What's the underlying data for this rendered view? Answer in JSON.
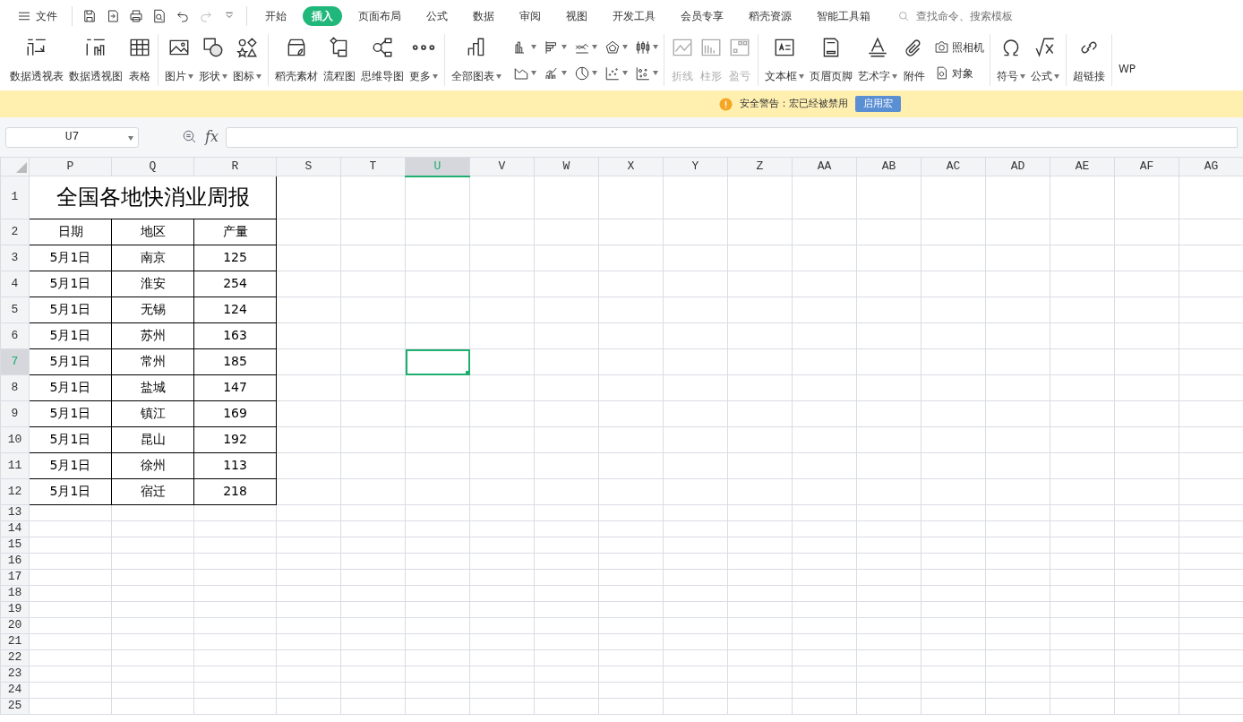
{
  "menu": {
    "file_label": "文件",
    "tabs": [
      {
        "label": "开始",
        "selected": false
      },
      {
        "label": "插入",
        "selected": true
      },
      {
        "label": "页面布局",
        "selected": false
      },
      {
        "label": "公式",
        "selected": false
      },
      {
        "label": "数据",
        "selected": false
      },
      {
        "label": "审阅",
        "selected": false
      },
      {
        "label": "视图",
        "selected": false
      },
      {
        "label": "开发工具",
        "selected": false
      },
      {
        "label": "会员专享",
        "selected": false
      },
      {
        "label": "稻壳资源",
        "selected": false
      },
      {
        "label": "智能工具箱",
        "selected": false
      }
    ],
    "search": {
      "placeholder": "查找命令、搜索模板"
    }
  },
  "ribbon": {
    "groups": [
      {
        "items": [
          {
            "kind": "large",
            "label": "数据透视表",
            "dropdown": false,
            "disabled": false
          },
          {
            "kind": "large",
            "label": "数据透视图",
            "dropdown": false,
            "disabled": false
          },
          {
            "kind": "large",
            "label": "表格",
            "dropdown": false,
            "disabled": false
          }
        ]
      },
      {
        "items": [
          {
            "kind": "large",
            "label": "图片",
            "dropdown": true,
            "disabled": false
          },
          {
            "kind": "large",
            "label": "形状",
            "dropdown": true,
            "disabled": false
          },
          {
            "kind": "large",
            "label": "图标",
            "dropdown": true,
            "disabled": false
          }
        ]
      },
      {
        "items": [
          {
            "kind": "large",
            "label": "稻壳素材",
            "dropdown": false,
            "disabled": false
          },
          {
            "kind": "large",
            "label": "流程图",
            "dropdown": false,
            "disabled": false
          },
          {
            "kind": "large",
            "label": "思维导图",
            "dropdown": false,
            "disabled": false
          },
          {
            "kind": "large",
            "label": "更多",
            "dropdown": true,
            "disabled": false
          }
        ]
      },
      {
        "items": [
          {
            "kind": "large",
            "label": "全部图表",
            "dropdown": true,
            "disabled": false
          },
          {
            "kind": "chart-grid"
          }
        ]
      },
      {
        "items": [
          {
            "kind": "large",
            "label": "折线",
            "dropdown": false,
            "disabled": true
          },
          {
            "kind": "large",
            "label": "柱形",
            "dropdown": false,
            "disabled": true
          },
          {
            "kind": "large",
            "label": "盈亏",
            "dropdown": false,
            "disabled": true
          }
        ]
      },
      {
        "items": [
          {
            "kind": "large",
            "label": "文本框",
            "dropdown": true,
            "disabled": false
          },
          {
            "kind": "large",
            "label": "页眉页脚",
            "dropdown": false,
            "disabled": false
          },
          {
            "kind": "large",
            "label": "艺术字",
            "dropdown": true,
            "disabled": false
          },
          {
            "kind": "large",
            "label": "附件",
            "dropdown": false,
            "disabled": false
          },
          {
            "kind": "small-pair",
            "labels": [
              "照相机",
              "对象"
            ]
          }
        ]
      },
      {
        "items": [
          {
            "kind": "large",
            "label": "符号",
            "dropdown": true,
            "disabled": false
          },
          {
            "kind": "large",
            "label": "公式",
            "dropdown": true,
            "disabled": false
          }
        ]
      },
      {
        "items": [
          {
            "kind": "large",
            "label": "超链接",
            "dropdown": false,
            "disabled": false
          }
        ]
      },
      {
        "items": [
          {
            "kind": "cut",
            "label": "WP"
          }
        ]
      }
    ]
  },
  "security_bar": {
    "message": "安全警告：宏已经被禁用",
    "button": "启用宏"
  },
  "formula_bar": {
    "name_box": "U7",
    "fx_label": "fx"
  },
  "sheet": {
    "columns": [
      {
        "label": "P",
        "selected": false
      },
      {
        "label": "Q",
        "selected": false
      },
      {
        "label": "R",
        "selected": false
      },
      {
        "label": "S",
        "selected": false
      },
      {
        "label": "T",
        "selected": false
      },
      {
        "label": "U",
        "selected": true
      },
      {
        "label": "V",
        "selected": false
      },
      {
        "label": "W",
        "selected": false
      },
      {
        "label": "X",
        "selected": false
      },
      {
        "label": "Y",
        "selected": false
      },
      {
        "label": "Z",
        "selected": false
      },
      {
        "label": "AA",
        "selected": false
      },
      {
        "label": "AB",
        "selected": false
      },
      {
        "label": "AC",
        "selected": false
      },
      {
        "label": "AD",
        "selected": false
      },
      {
        "label": "AE",
        "selected": false
      },
      {
        "label": "AF",
        "selected": false
      },
      {
        "label": "AG",
        "selected": false
      }
    ],
    "rows": [
      {
        "number": "1",
        "selected": false,
        "kind": "title",
        "cells": [
          "全国各地快消业周报"
        ]
      },
      {
        "number": "2",
        "selected": false,
        "kind": "table",
        "cells": [
          "日期",
          "地区",
          "产量"
        ]
      },
      {
        "number": "3",
        "selected": false,
        "kind": "table",
        "cells": [
          "5月1日",
          "南京",
          "125"
        ]
      },
      {
        "number": "4",
        "selected": false,
        "kind": "table",
        "cells": [
          "5月1日",
          "淮安",
          "254"
        ]
      },
      {
        "number": "5",
        "selected": false,
        "kind": "table",
        "cells": [
          "5月1日",
          "无锡",
          "124"
        ]
      },
      {
        "number": "6",
        "selected": false,
        "kind": "table",
        "cells": [
          "5月1日",
          "苏州",
          "163"
        ]
      },
      {
        "number": "7",
        "selected": true,
        "kind": "table",
        "cells": [
          "5月1日",
          "常州",
          "185"
        ]
      },
      {
        "number": "8",
        "selected": false,
        "kind": "table",
        "cells": [
          "5月1日",
          "盐城",
          "147"
        ]
      },
      {
        "number": "9",
        "selected": false,
        "kind": "table",
        "cells": [
          "5月1日",
          "镇江",
          "169"
        ]
      },
      {
        "number": "10",
        "selected": false,
        "kind": "table",
        "cells": [
          "5月1日",
          "昆山",
          "192"
        ]
      },
      {
        "number": "11",
        "selected": false,
        "kind": "table",
        "cells": [
          "5月1日",
          "徐州",
          "113"
        ]
      },
      {
        "number": "12",
        "selected": false,
        "kind": "table",
        "cells": [
          "5月1日",
          "宿迁",
          "218"
        ]
      },
      {
        "number": "13",
        "selected": false,
        "kind": "empty"
      },
      {
        "number": "14",
        "selected": false,
        "kind": "empty"
      },
      {
        "number": "15",
        "selected": false,
        "kind": "empty"
      },
      {
        "number": "16",
        "selected": false,
        "kind": "empty"
      },
      {
        "number": "17",
        "selected": false,
        "kind": "empty"
      },
      {
        "number": "18",
        "selected": false,
        "kind": "empty"
      },
      {
        "number": "19",
        "selected": false,
        "kind": "empty"
      },
      {
        "number": "20",
        "selected": false,
        "kind": "empty"
      },
      {
        "number": "21",
        "selected": false,
        "kind": "empty"
      },
      {
        "number": "22",
        "selected": false,
        "kind": "empty"
      },
      {
        "number": "23",
        "selected": false,
        "kind": "empty"
      },
      {
        "number": "24",
        "selected": false,
        "kind": "empty"
      },
      {
        "number": "25",
        "selected": false,
        "kind": "empty"
      }
    ]
  }
}
